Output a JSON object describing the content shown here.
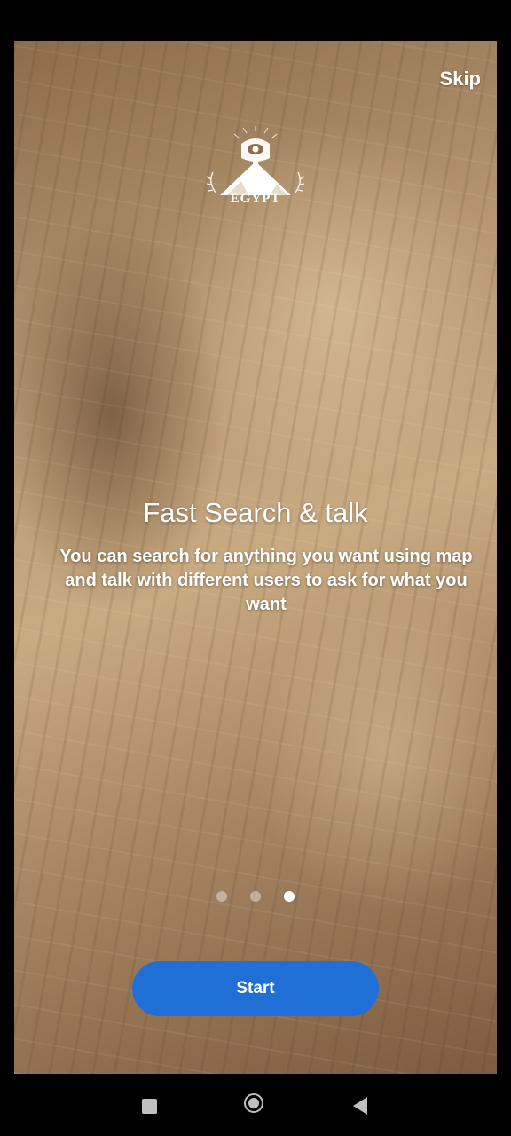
{
  "onboarding": {
    "skip_label": "Skip",
    "logo_text": "EGYPT",
    "title": "Fast Search & talk",
    "description": "You can search for anything you want using map and talk with different users to ask for what you want",
    "page_count": 3,
    "active_page": 3,
    "start_label": "Start"
  },
  "colors": {
    "accent": "#1f6fd6",
    "text": "#ffffff"
  },
  "navbar": {
    "recents_icon": "square-icon",
    "home_icon": "circle-home-icon",
    "back_icon": "triangle-back-icon"
  }
}
